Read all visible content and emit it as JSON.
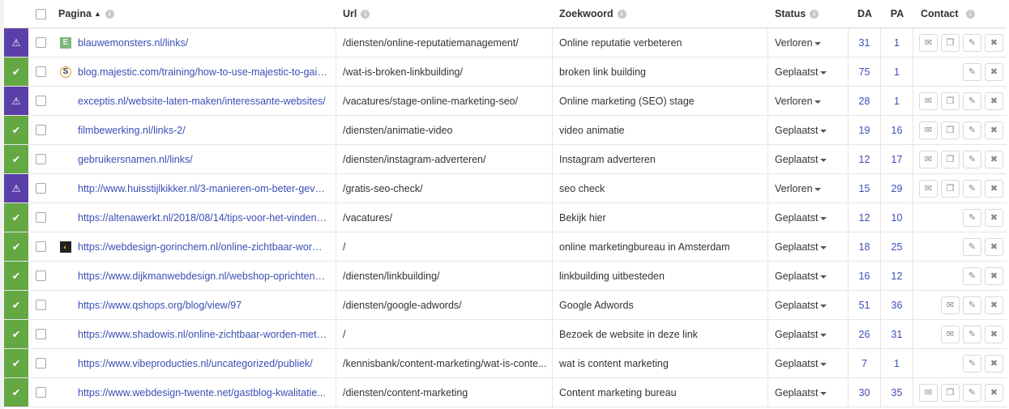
{
  "header": {
    "page": "Pagina",
    "url": "Url",
    "keyword": "Zoekwoord",
    "status": "Status",
    "da": "DA",
    "pa": "PA",
    "contact": "Contact",
    "sort_icon": "sort-ascending-icon",
    "info_icon": "info-icon"
  },
  "colors": {
    "ok": "#64a844",
    "warn": "#5b3fa8",
    "link": "#3a4fb5"
  },
  "rows": [
    {
      "state": "warn",
      "favicon": "E",
      "page": "blauwemonsters.nl/links/",
      "url": "/diensten/online-reputatiemanagement/",
      "keyword": "Online reputatie verbeteren",
      "status": "Verloren",
      "da": "31",
      "pa": "1",
      "buttons": [
        "mail",
        "copy",
        "edit",
        "delete"
      ]
    },
    {
      "state": "ok",
      "favicon": "S",
      "page": "blog.majestic.com/training/how-to-use-majestic-to-gain...",
      "url": "/wat-is-broken-linkbuilding/",
      "keyword": "broken link building",
      "status": "Geplaatst",
      "da": "75",
      "pa": "1",
      "buttons": [
        "edit",
        "delete"
      ]
    },
    {
      "state": "warn",
      "favicon": "",
      "page": "exceptis.nl/website-laten-maken/interessante-websites/",
      "url": "/vacatures/stage-online-marketing-seo/",
      "keyword": "Online marketing (SEO) stage",
      "status": "Verloren",
      "da": "28",
      "pa": "1",
      "buttons": [
        "mail",
        "copy",
        "edit",
        "delete"
      ]
    },
    {
      "state": "ok",
      "favicon": "",
      "page": "filmbewerking.nl/links-2/",
      "url": "/diensten/animatie-video",
      "keyword": "video animatie",
      "status": "Geplaatst",
      "da": "19",
      "pa": "16",
      "buttons": [
        "mail",
        "copy",
        "edit",
        "delete"
      ]
    },
    {
      "state": "ok",
      "favicon": "",
      "page": "gebruikersnamen.nl/links/",
      "url": "/diensten/instagram-adverteren/",
      "keyword": "Instagram adverteren",
      "status": "Geplaatst",
      "da": "12",
      "pa": "17",
      "buttons": [
        "mail",
        "copy",
        "edit",
        "delete"
      ]
    },
    {
      "state": "warn",
      "favicon": "",
      "page": "http://www.huisstijlkikker.nl/3-manieren-om-beter-gevo...",
      "url": "/gratis-seo-check/",
      "keyword": "seo check",
      "status": "Verloren",
      "da": "15",
      "pa": "29",
      "buttons": [
        "mail",
        "copy",
        "edit",
        "delete"
      ]
    },
    {
      "state": "ok",
      "favicon": "",
      "page": "https://altenawerkt.nl/2018/08/14/tips-voor-het-vinden-...",
      "url": "/vacatures/",
      "keyword": "Bekijk hier",
      "status": "Geplaatst",
      "da": "12",
      "pa": "10",
      "buttons": [
        "edit",
        "delete"
      ]
    },
    {
      "state": "ok",
      "favicon": "C",
      "page": "https://webdesign-gorinchem.nl/online-zichtbaar-worde...",
      "url": "/",
      "keyword": "online marketingbureau in Amsterdam",
      "status": "Geplaatst",
      "da": "18",
      "pa": "25",
      "buttons": [
        "edit",
        "delete"
      ]
    },
    {
      "state": "ok",
      "favicon": "",
      "page": "https://www.dijkmanwebdesign.nl/webshop-oprichten-i...",
      "url": "/diensten/linkbuilding/",
      "keyword": "linkbuilding uitbesteden",
      "status": "Geplaatst",
      "da": "16",
      "pa": "12",
      "buttons": [
        "edit",
        "delete"
      ]
    },
    {
      "state": "ok",
      "favicon": "",
      "page": "https://www.qshops.org/blog/view/97",
      "url": "/diensten/google-adwords/",
      "keyword": "Google Adwords",
      "status": "Geplaatst",
      "da": "51",
      "pa": "36",
      "buttons": [
        "mail",
        "edit",
        "delete"
      ]
    },
    {
      "state": "ok",
      "favicon": "",
      "page": "https://www.shadowis.nl/online-zichtbaar-worden-met-...",
      "url": "/",
      "keyword": "Bezoek de website in deze link",
      "status": "Geplaatst",
      "da": "26",
      "pa": "31",
      "buttons": [
        "mail",
        "edit",
        "delete"
      ]
    },
    {
      "state": "ok",
      "favicon": "",
      "page": "https://www.vibeproducties.nl/uncategorized/publiek/",
      "url": "/kennisbank/content-marketing/wat-is-conte...",
      "keyword": "wat is content marketing",
      "status": "Geplaatst",
      "da": "7",
      "pa": "1",
      "buttons": [
        "edit",
        "delete"
      ]
    },
    {
      "state": "ok",
      "favicon": "",
      "page": "https://www.webdesign-twente.net/gastblog-kwalitatie...",
      "url": "/diensten/content-marketing",
      "keyword": "Content marketing bureau",
      "status": "Geplaatst",
      "da": "30",
      "pa": "35",
      "buttons": [
        "mail",
        "copy",
        "edit",
        "delete"
      ]
    }
  ]
}
